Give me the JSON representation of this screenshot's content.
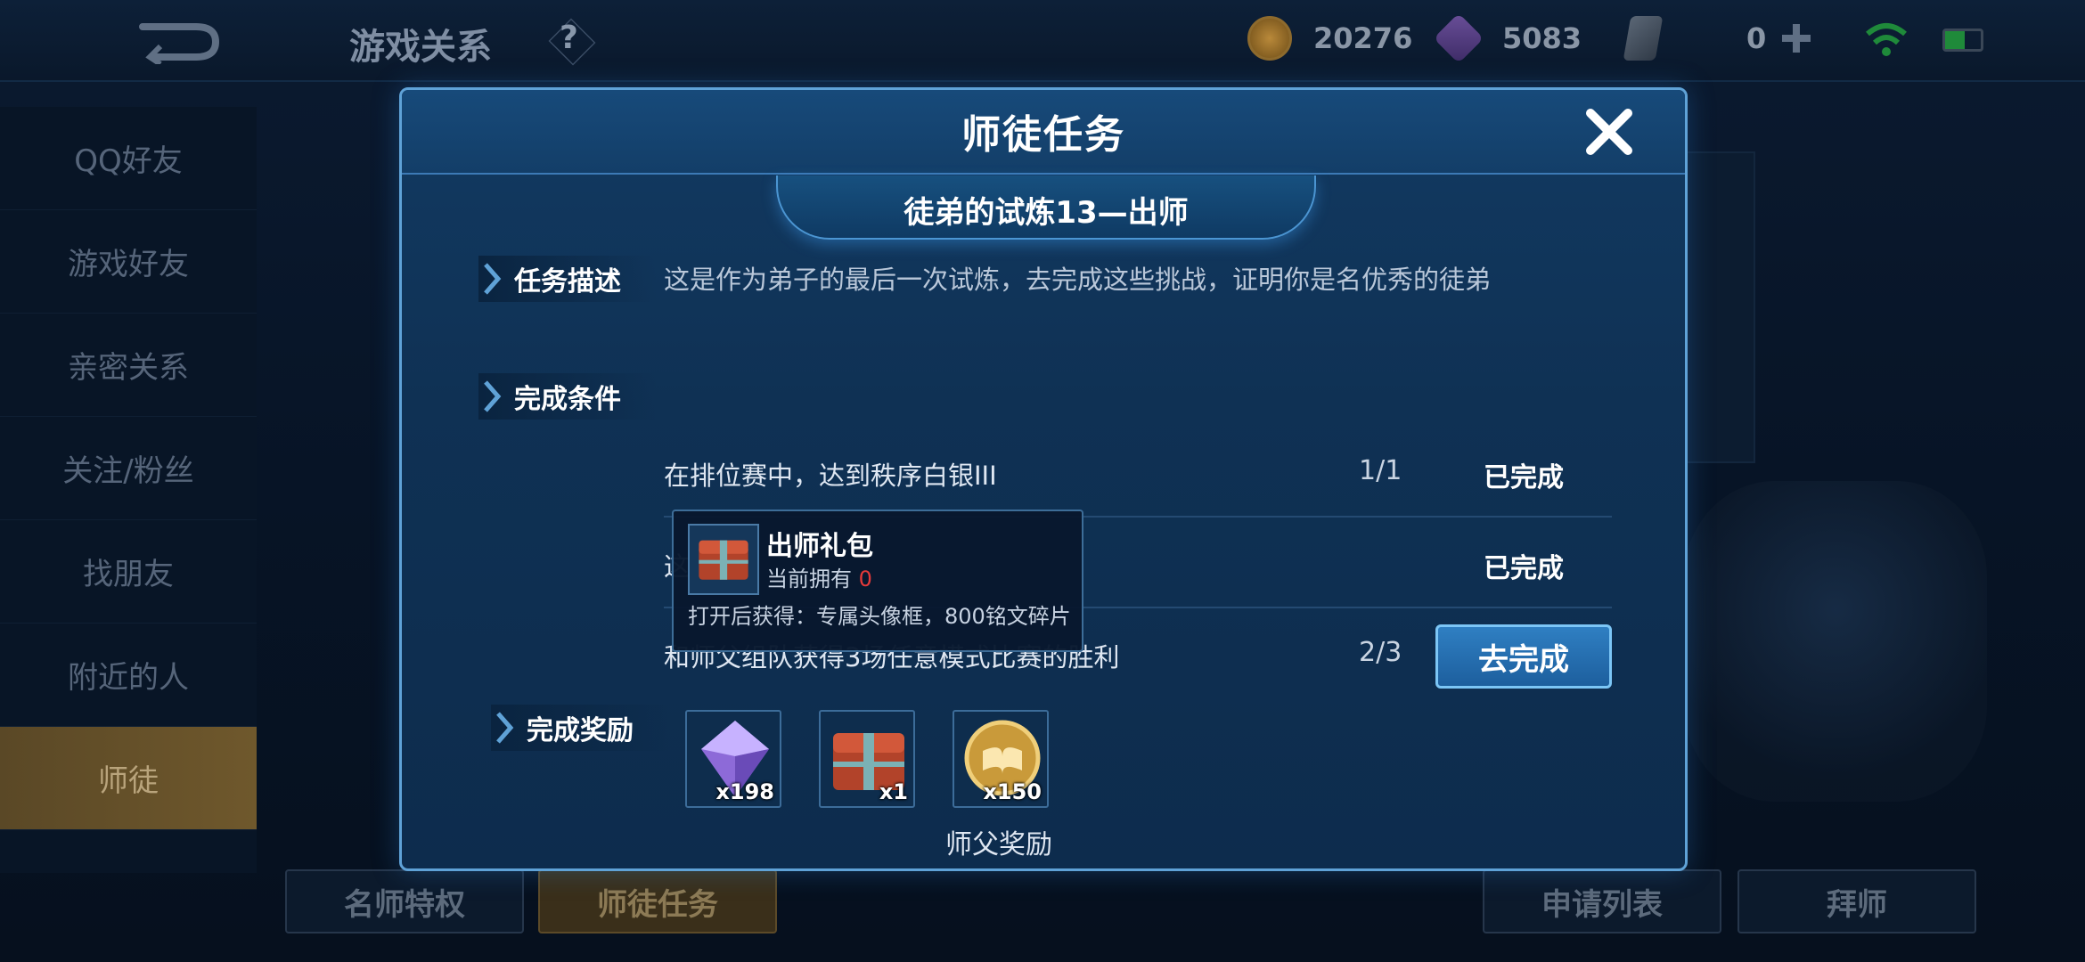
{
  "topbar": {
    "title": "游戏关系",
    "help_label": "?",
    "resources": [
      {
        "icon": "gold-coin-icon",
        "value": "20276"
      },
      {
        "icon": "diamond-icon",
        "value": "5083"
      },
      {
        "icon": "card-icon",
        "value": "0"
      }
    ]
  },
  "sidebar": {
    "items": [
      {
        "label": "QQ好友"
      },
      {
        "label": "游戏好友"
      },
      {
        "label": "亲密关系"
      },
      {
        "label": "关注/粉丝"
      },
      {
        "label": "找朋友"
      },
      {
        "label": "附近的人"
      },
      {
        "label": "师徒"
      }
    ]
  },
  "bottom_tabs": [
    "名师特权",
    "师徒任务",
    "申请列表",
    "拜师"
  ],
  "modal": {
    "title": "师徒任务",
    "subtitle": "徒弟的试炼13—出师",
    "description_label": "任务描述",
    "description": "这是作为弟子的最后一次试炼，去完成这些挑战，证明你是名优秀的徒弟",
    "conditions_label": "完成条件",
    "conditions": [
      {
        "task": "在排位赛中，达到秩序白银III",
        "progress": "1/1",
        "status": "已完成"
      },
      {
        "task": "这",
        "progress": "",
        "status": "已完成"
      },
      {
        "task": "和师父组队获得3场任意模式比赛的胜利",
        "progress": "2/3",
        "status": ""
      }
    ],
    "go_button": "去完成",
    "rewards_label": "完成奖励",
    "rewards": [
      {
        "icon": "purple-crystal-icon",
        "count": "x198"
      },
      {
        "icon": "graduation-gift-chest-icon",
        "count": "x1"
      },
      {
        "icon": "gold-medal-book-icon",
        "count": "x150"
      }
    ],
    "master_reward_label": "师父奖励"
  },
  "tooltip": {
    "name": "出师礼包",
    "own_prefix": "当前拥有",
    "own_count": "0",
    "description": "打开后获得：专属头像框，800铭文碎片"
  }
}
